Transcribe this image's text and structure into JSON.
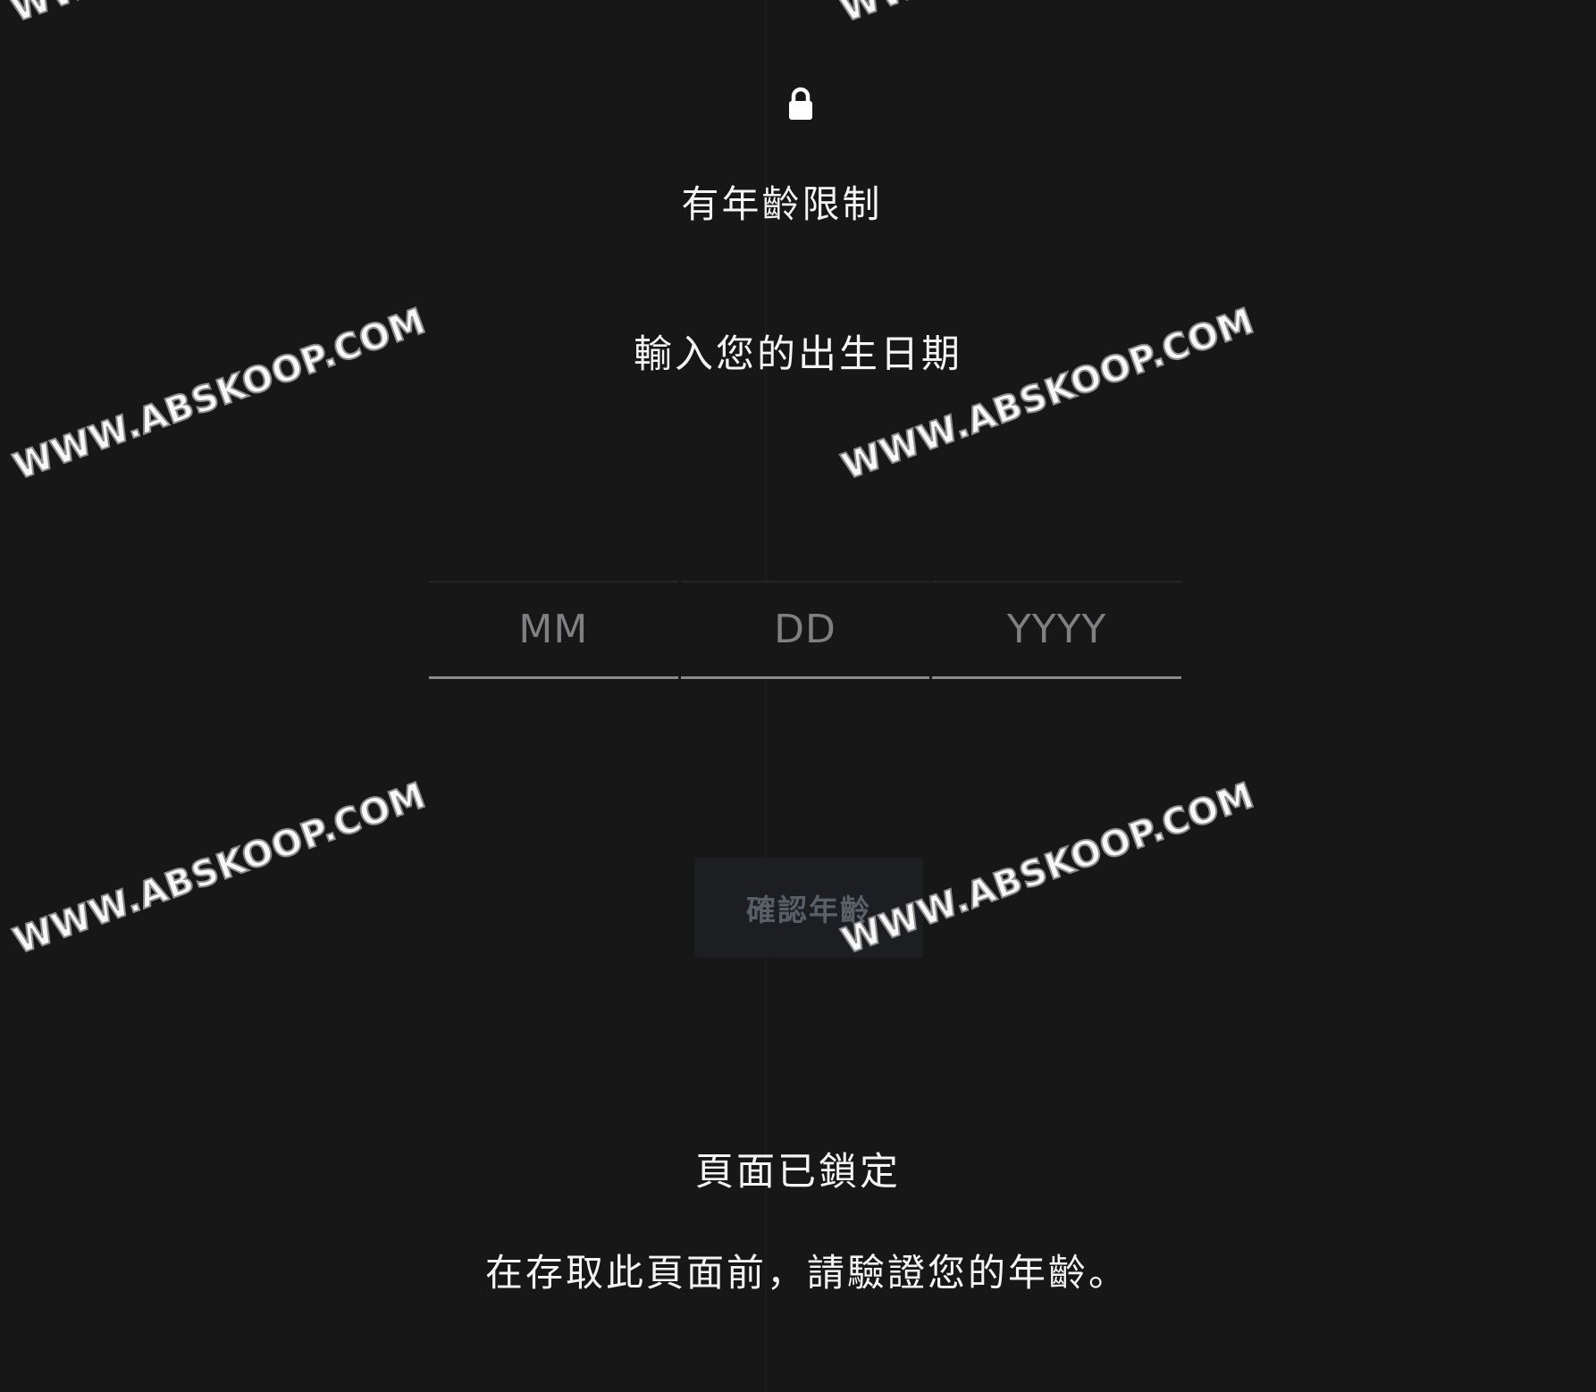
{
  "lock_screen": {
    "restricted_title": "有年齡限制",
    "dob_prompt": "輸入您的出生日期",
    "dob": {
      "month": {
        "placeholder": "MM",
        "value": ""
      },
      "day": {
        "placeholder": "DD",
        "value": ""
      },
      "year": {
        "placeholder": "YYYY",
        "value": ""
      }
    },
    "confirm_button_label": "確認年齡",
    "locked_title": "頁面已鎖定",
    "locked_message": "在存取此頁面前，請驗證您的年齡。"
  },
  "watermarks": [
    "WWW.ABSKOOP.COM",
    "WWW.ABSKOOP.COM",
    "WWW.ABSKOOP.COM",
    "WWW.ABSKOOP.COM",
    "WW",
    "WW"
  ],
  "colors": {
    "background": "#171718",
    "text": "#f4f4f4",
    "placeholder": "#808083",
    "button_bg": "#1d1e21",
    "button_text": "#586067"
  },
  "icons": {
    "lock": "lock-icon"
  }
}
